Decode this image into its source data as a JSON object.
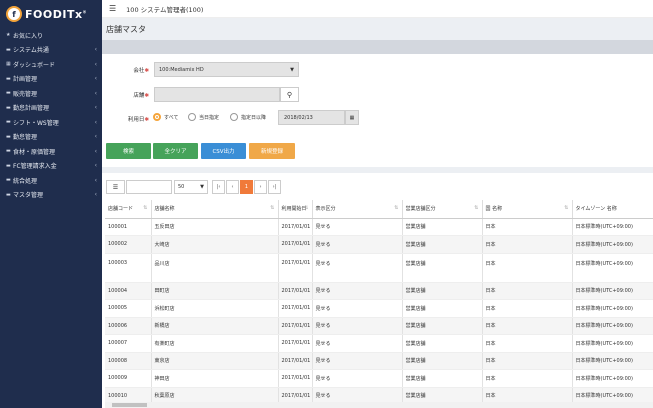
{
  "app": {
    "logo_mark": "f",
    "logo_text": "FOODITx",
    "logo_sup": "®",
    "top_title": "100 システム管理者(100)"
  },
  "sidebar": {
    "items": [
      {
        "icon": "★",
        "label": "お気に入り",
        "chevron": ""
      },
      {
        "icon": "▬",
        "label": "システム共通",
        "chevron": "‹"
      },
      {
        "icon": "▦",
        "label": "ダッシュボード",
        "chevron": "‹"
      },
      {
        "icon": "▬",
        "label": "計画管理",
        "chevron": "‹"
      },
      {
        "icon": "▬",
        "label": "販売管理",
        "chevron": "‹"
      },
      {
        "icon": "▬",
        "label": "勤怠計画管理",
        "chevron": "‹"
      },
      {
        "icon": "▬",
        "label": "シフト・WS管理",
        "chevron": "‹"
      },
      {
        "icon": "▬",
        "label": "勤怠管理",
        "chevron": "‹"
      },
      {
        "icon": "▬",
        "label": "食材・原価管理",
        "chevron": "‹"
      },
      {
        "icon": "▬",
        "label": "FC管理請求入金",
        "chevron": "‹"
      },
      {
        "icon": "▬",
        "label": "統合処理",
        "chevron": "‹"
      },
      {
        "icon": "▬",
        "label": "マスタ管理",
        "chevron": "‹"
      }
    ]
  },
  "page": {
    "title": "店舗マスタ"
  },
  "form": {
    "company_label": "会社",
    "company_value": "100:Mediamix HD",
    "store_label": "店舗",
    "date_label": "利用日",
    "radio_all": "すべて",
    "radio_day": "当日指定",
    "radio_after": "指定日以降",
    "date_value": "2018/02/13",
    "req_mark": "✱"
  },
  "buttons": {
    "search": "検索",
    "clear": "全クリア",
    "csv": "CSV出力",
    "new": "新規登録"
  },
  "toolbar": {
    "page_size": "50",
    "current_page": "1"
  },
  "table": {
    "headers": [
      "店舗コード",
      "店舗名称",
      "利用開始日",
      "表示区分",
      "営業店舗区分",
      "国 名称",
      "タイムゾーン 名称"
    ],
    "rows": [
      [
        "100001",
        "五反田店",
        "2017/01/01",
        "見せる",
        "営業店舗",
        "日本",
        "日本標準時(UTC+09:00)"
      ],
      [
        "100002",
        "大崎店",
        "2017/01/01",
        "見せる",
        "営業店舗",
        "日本",
        "日本標準時(UTC+09:00)"
      ],
      [
        "100003",
        "品川店",
        "2017/01/01",
        "見せる",
        "営業店舗",
        "日本",
        "日本標準時(UTC+09:00)"
      ],
      [
        "100004",
        "田町店",
        "2017/01/01",
        "見せる",
        "営業店舗",
        "日本",
        "日本標準時(UTC+09:00)"
      ],
      [
        "100005",
        "浜松町店",
        "2017/01/01",
        "見せる",
        "営業店舗",
        "日本",
        "日本標準時(UTC+09:00)"
      ],
      [
        "100006",
        "新橋店",
        "2017/01/01",
        "見せる",
        "営業店舗",
        "日本",
        "日本標準時(UTC+09:00)"
      ],
      [
        "100007",
        "有楽町店",
        "2017/01/01",
        "見せる",
        "営業店舗",
        "日本",
        "日本標準時(UTC+09:00)"
      ],
      [
        "100008",
        "東京店",
        "2017/01/01",
        "見せる",
        "営業店舗",
        "日本",
        "日本標準時(UTC+09:00)"
      ],
      [
        "100009",
        "神田店",
        "2017/01/01",
        "見せる",
        "営業店舗",
        "日本",
        "日本標準時(UTC+09:00)"
      ],
      [
        "100010",
        "秋葉原店",
        "2017/01/01",
        "見せる",
        "営業店舗",
        "日本",
        "日本標準時(UTC+09:00)"
      ]
    ]
  }
}
